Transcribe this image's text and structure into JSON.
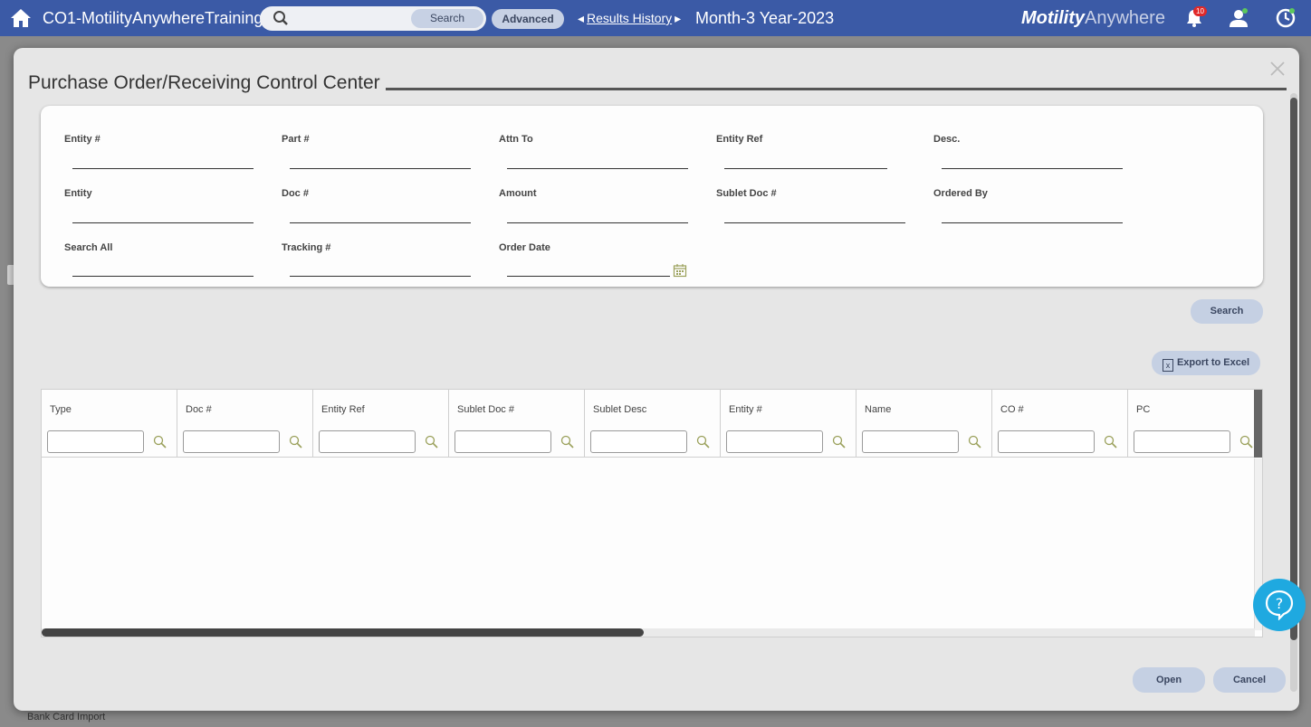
{
  "topbar": {
    "app_title": "CO1-MotilityAnywhereTraining",
    "search_button": "Search",
    "advanced_button": "Advanced",
    "results_history": "Results History",
    "period": "Month-3 Year-2023",
    "brand_bold": "Motility",
    "brand_light": "Anywhere",
    "notification_count": "10"
  },
  "modal": {
    "title": "Purchase Order/Receiving Control Center",
    "fields": [
      {
        "label": "Entity #"
      },
      {
        "label": "Part #"
      },
      {
        "label": "Attn To"
      },
      {
        "label": "Entity Ref"
      },
      {
        "label": "Desc."
      },
      {
        "label": "Entity"
      },
      {
        "label": "Doc #"
      },
      {
        "label": "Amount"
      },
      {
        "label": "Sublet Doc #"
      },
      {
        "label": "Ordered By"
      },
      {
        "label": "Search All"
      },
      {
        "label": "Tracking #"
      },
      {
        "label": "Order Date"
      }
    ],
    "search_button": "Search",
    "export_button": "Export to Excel",
    "columns": [
      "Type",
      "Doc #",
      "Entity Ref",
      "Sublet Doc #",
      "Sublet Desc",
      "Entity #",
      "Name",
      "CO #",
      "PC"
    ],
    "open_button": "Open",
    "cancel_button": "Cancel"
  },
  "background": {
    "peek_text": "Bank Card Import"
  }
}
